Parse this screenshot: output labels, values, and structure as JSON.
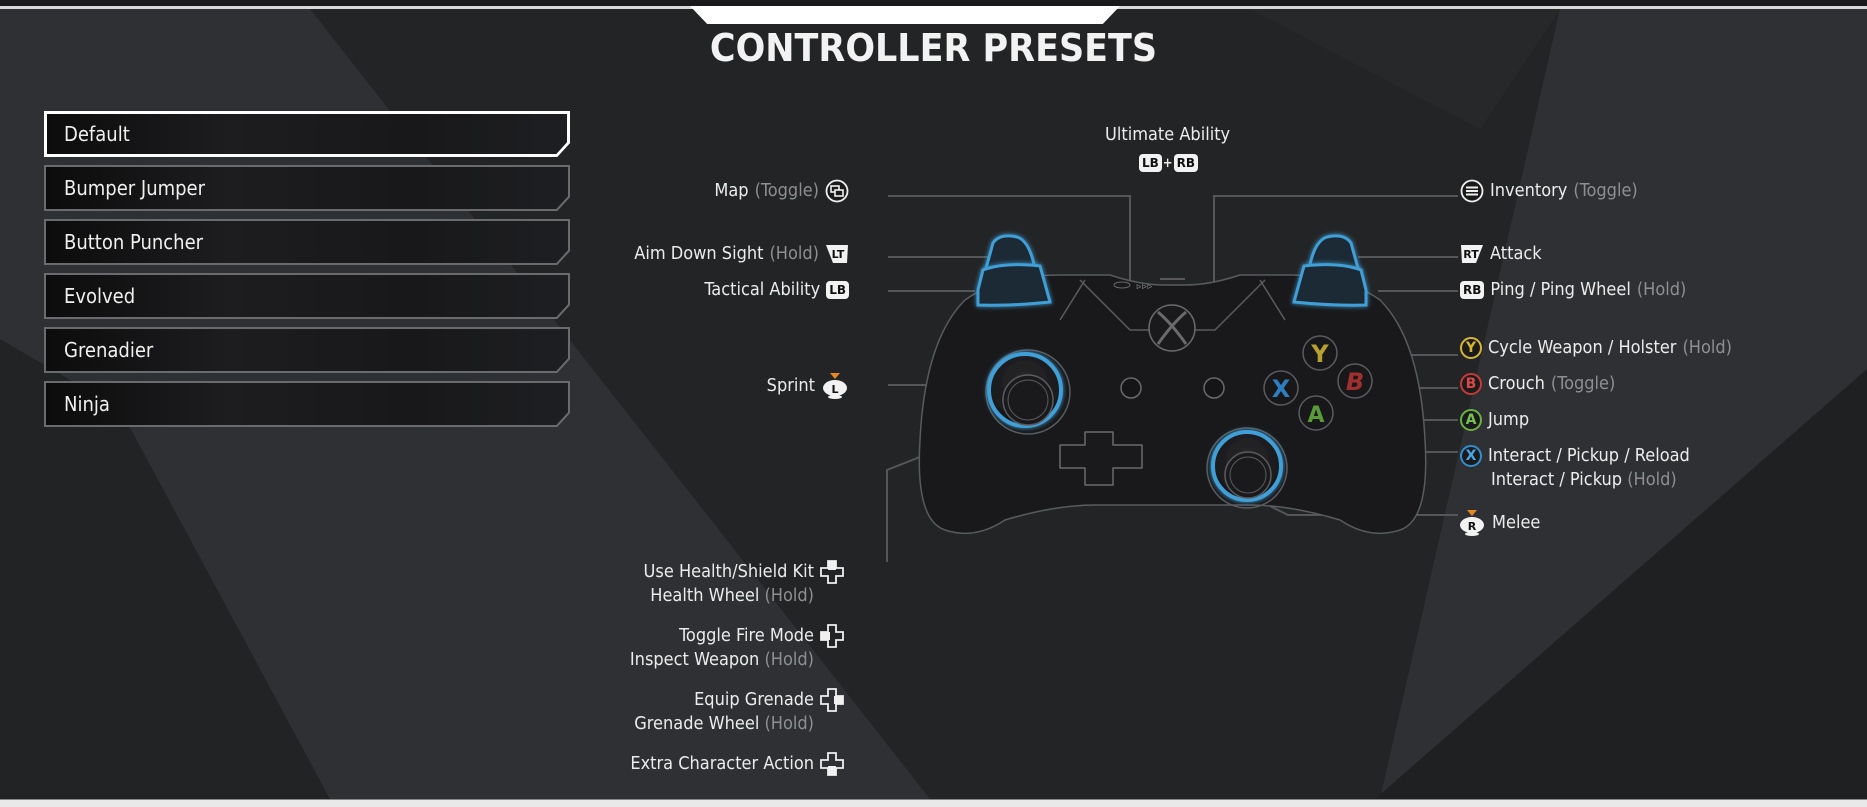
{
  "header": {
    "title": "CONTROLLER PRESETS"
  },
  "presets": {
    "selected": "Default",
    "items": [
      {
        "label": "Default"
      },
      {
        "label": "Bumper Jumper"
      },
      {
        "label": "Button Puncher"
      },
      {
        "label": "Evolved"
      },
      {
        "label": "Grenadier"
      },
      {
        "label": "Ninja"
      }
    ]
  },
  "colors": {
    "accent_blue": "#3f9fd6",
    "btn_y": "#d8b533",
    "btn_b": "#c83a3a",
    "btn_a": "#67b243",
    "btn_x": "#2f8fd0",
    "stick_marker": "#e8891f",
    "modifier_text": "#8f8f92"
  },
  "bindings": {
    "ultimate": {
      "action": "Ultimate Ability",
      "combo": {
        "left": "LB",
        "plus": "+",
        "right": "RB"
      }
    },
    "map": {
      "action": "Map",
      "modifier": "(Toggle)",
      "button": "view-button"
    },
    "aim": {
      "action": "Aim Down Sight",
      "modifier": "(Hold)",
      "button": "LT"
    },
    "tactical": {
      "action": "Tactical Ability",
      "button": "LB"
    },
    "sprint": {
      "action": "Sprint",
      "button": "L"
    },
    "dpad_up": {
      "action": "Use Health/Shield Kit",
      "hold_action": "Health Wheel",
      "modifier": "(Hold)"
    },
    "dpad_left": {
      "action": "Toggle Fire Mode",
      "hold_action": "Inspect Weapon",
      "modifier": "(Hold)"
    },
    "dpad_right": {
      "action": "Equip Grenade",
      "hold_action": "Grenade Wheel",
      "modifier": "(Hold)"
    },
    "dpad_down": {
      "action": "Extra Character Action"
    },
    "inventory": {
      "action": "Inventory",
      "modifier": "(Toggle)",
      "button": "menu-button"
    },
    "attack": {
      "action": "Attack",
      "button": "RT"
    },
    "ping": {
      "action": "Ping / Ping Wheel",
      "modifier": "(Hold)",
      "button": "RB"
    },
    "y": {
      "action": "Cycle Weapon / Holster",
      "modifier": "(Hold)",
      "button": "Y"
    },
    "b": {
      "action": "Crouch",
      "modifier": "(Toggle)",
      "button": "B"
    },
    "a": {
      "action": "Jump",
      "button": "A"
    },
    "x": {
      "action": "Interact / Pickup / Reload",
      "hold_action": "Interact / Pickup",
      "modifier": "(Hold)",
      "button": "X"
    },
    "melee": {
      "action": "Melee",
      "button": "R"
    }
  },
  "controller": {
    "face_buttons": {
      "y": "Y",
      "b": "B",
      "a": "A",
      "x": "X"
    }
  }
}
